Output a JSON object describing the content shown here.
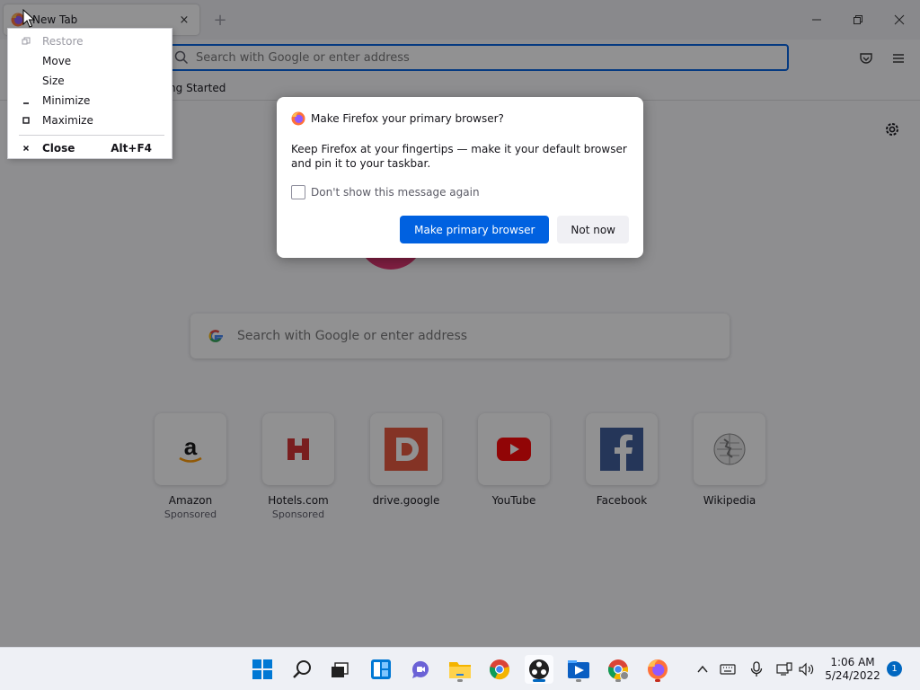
{
  "tab": {
    "title": "New Tab",
    "close_glyph": "×"
  },
  "tabbar": {
    "new_tab_glyph": "+"
  },
  "window_controls": [
    "minimize-icon",
    "restore-icon",
    "close-icon"
  ],
  "urlbar": {
    "placeholder": "Search with Google or enter address",
    "icon": "search-icon"
  },
  "toolbar_icons": [
    "pocket-icon",
    "hamburger-menu-icon"
  ],
  "bookmarks": [
    {
      "label": "Getting Started",
      "visible_text": "ting Started",
      "icon": "firefox-icon"
    }
  ],
  "newtab": {
    "search_placeholder": "Search with Google or enter address",
    "settings_icon": "gear-icon",
    "tiles": [
      {
        "title": "Amazon",
        "sub": "Sponsored",
        "icon": "amazon-icon"
      },
      {
        "title": "Hotels.com",
        "sub": "Sponsored",
        "icon": "hotels-icon"
      },
      {
        "title": "drive.google",
        "sub": "",
        "icon": "drive-icon"
      },
      {
        "title": "YouTube",
        "sub": "",
        "icon": "youtube-icon"
      },
      {
        "title": "Facebook",
        "sub": "",
        "icon": "facebook-icon"
      },
      {
        "title": "Wikipedia",
        "sub": "",
        "icon": "wikipedia-icon"
      }
    ]
  },
  "dialog": {
    "title": "Make Firefox your primary browser?",
    "body": "Keep Firefox at your fingertips — make it your default browser and pin it to your taskbar.",
    "checkbox_label": "Don't show this message again",
    "checkbox_checked": false,
    "primary_button": "Make primary browser",
    "secondary_button": "Not now"
  },
  "system_menu": {
    "items": [
      {
        "label": "Restore",
        "icon": "restore-icon",
        "disabled": true,
        "shortcut": ""
      },
      {
        "label": "Move",
        "icon": "",
        "disabled": false,
        "shortcut": ""
      },
      {
        "label": "Size",
        "icon": "",
        "disabled": false,
        "shortcut": ""
      },
      {
        "label": "Minimize",
        "icon": "minimize-icon",
        "disabled": false,
        "shortcut": ""
      },
      {
        "label": "Maximize",
        "icon": "maximize-icon",
        "disabled": false,
        "shortcut": ""
      },
      {
        "label": "Close",
        "icon": "close-icon",
        "disabled": false,
        "shortcut": "Alt+F4"
      }
    ]
  },
  "taskbar": {
    "apps": [
      "windows-start-icon",
      "search-icon",
      "task-view-icon",
      "widgets-icon",
      "teams-chat-icon",
      "file-explorer-icon",
      "chrome-icon",
      "obs-icon",
      "media-player-icon",
      "chrome-profile-icon",
      "firefox-icon"
    ],
    "tray": [
      "chevron-up-icon",
      "keyboard-icon",
      "microphone-icon",
      "network-icon",
      "speaker-icon"
    ],
    "clock_time": "1:06 AM",
    "clock_date": "5/24/2022",
    "notification_count": "1"
  },
  "colors": {
    "accent": "#0061e0",
    "taskbar_accent": "#0067c0",
    "firefox_pink": "#e0316d"
  }
}
